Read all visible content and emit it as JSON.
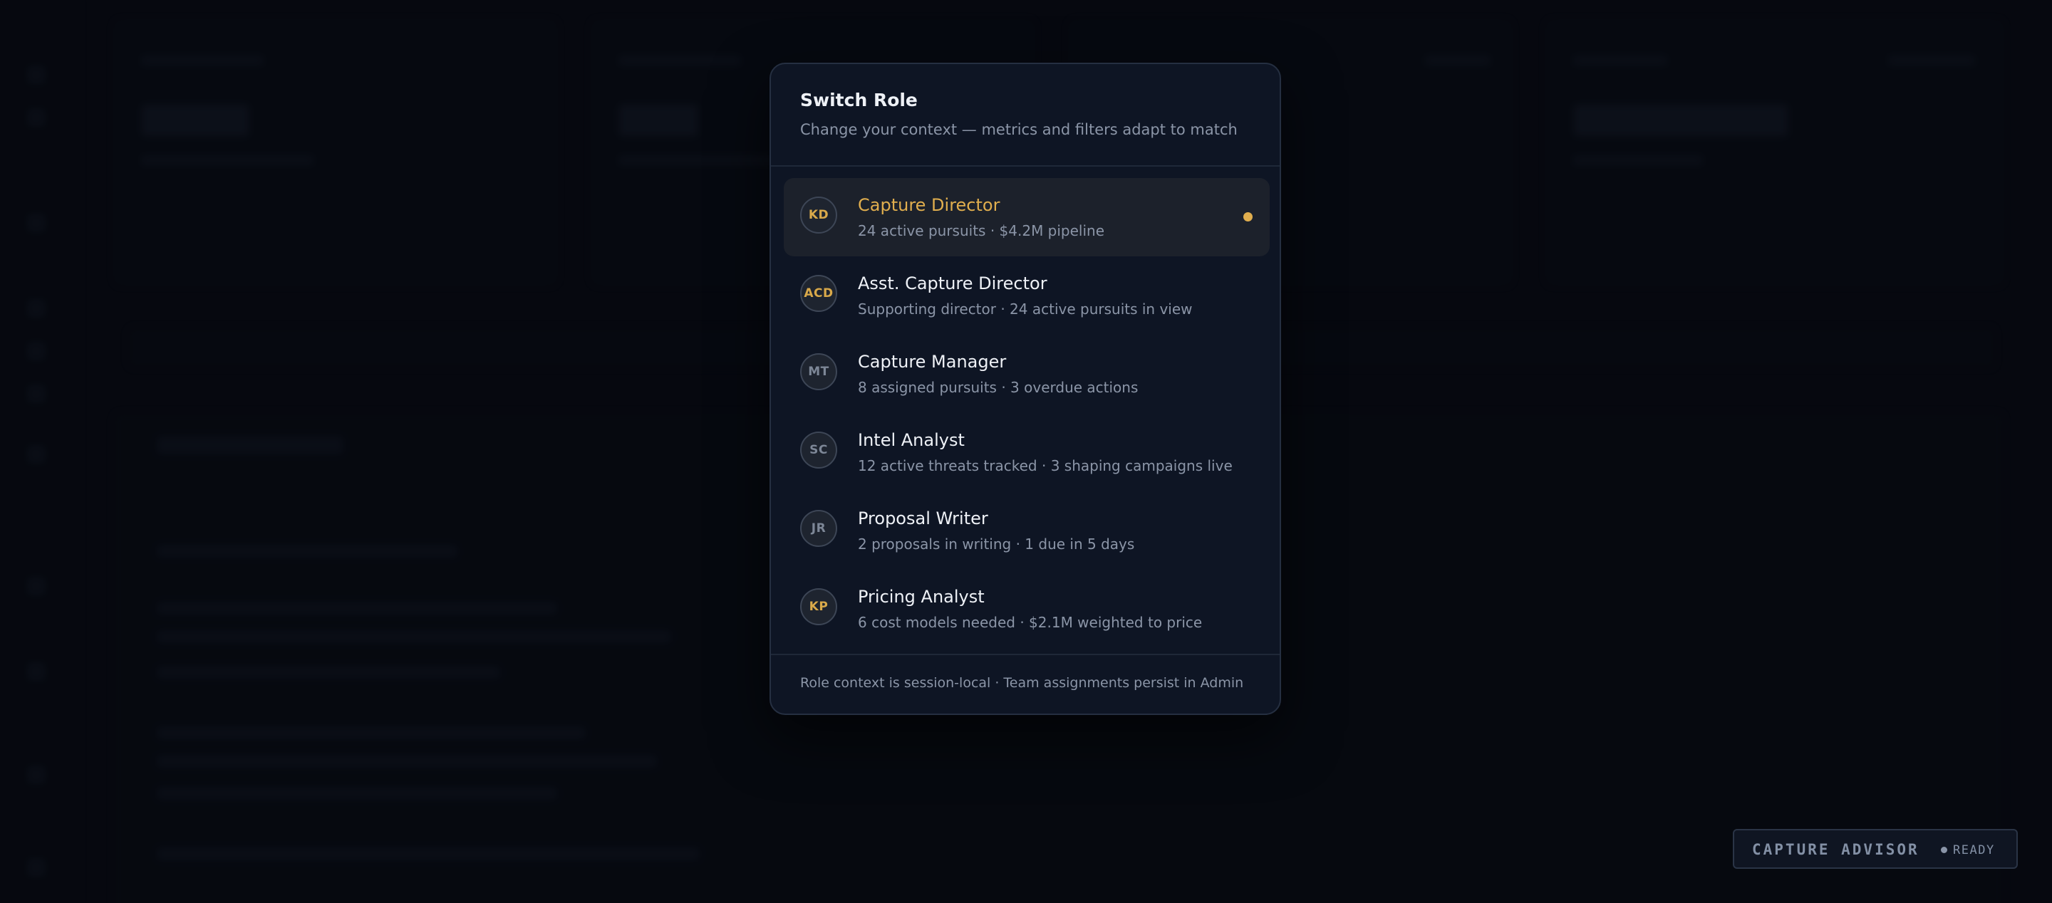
{
  "modal": {
    "title": "Switch Role",
    "subtitle": "Change your context — metrics and filters adapt to match",
    "footer": "Role context is session-local · Team assignments persist in Admin"
  },
  "roles": [
    {
      "initials": "KD",
      "name": "Capture Director",
      "description": "24 active pursuits · $4.2M pipeline",
      "active": true,
      "avatar_accent": "gold"
    },
    {
      "initials": "ACD",
      "name": "Asst. Capture Director",
      "description": "Supporting director · 24 active pursuits in view",
      "active": false,
      "avatar_accent": "gold"
    },
    {
      "initials": "MT",
      "name": "Capture Manager",
      "description": "8 assigned pursuits · 3 overdue actions",
      "active": false,
      "avatar_accent": "gray"
    },
    {
      "initials": "SC",
      "name": "Intel Analyst",
      "description": "12 active threats tracked · 3 shaping campaigns live",
      "active": false,
      "avatar_accent": "gray"
    },
    {
      "initials": "JR",
      "name": "Proposal Writer",
      "description": "2 proposals in writing · 1 due in 5 days",
      "active": false,
      "avatar_accent": "gray"
    },
    {
      "initials": "KP",
      "name": "Pricing Analyst",
      "description": "6 cost models needed · $2.1M weighted to price",
      "active": false,
      "avatar_accent": "gold"
    }
  ],
  "advisor": {
    "label": "CAPTURE ADVISOR",
    "status": "READY"
  },
  "colors": {
    "accent": "#e0ae4e",
    "background": "#090c14",
    "modal": "#0e1524",
    "text_muted": "#8b95a7"
  }
}
